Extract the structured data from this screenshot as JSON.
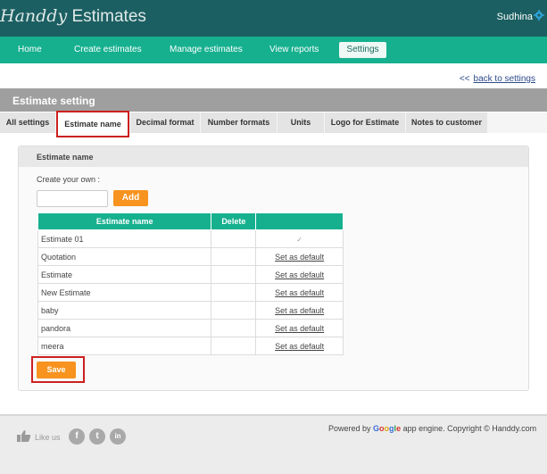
{
  "app": {
    "logo_script": "Handdy",
    "logo_rest": " Estimates",
    "user_name": "Sudhina"
  },
  "nav": {
    "items": [
      "Home",
      "Create estimates",
      "Manage estimates",
      "View reports"
    ],
    "settings": "Settings",
    "active": "Settings"
  },
  "back_link": {
    "arrow": "<<",
    "label": "back to settings"
  },
  "section_title": "Estimate setting",
  "tabs": [
    "All settings",
    "Estimate name",
    "Decimal format",
    "Number formats",
    "Units",
    "Logo for Estimate",
    "Notes to customer"
  ],
  "active_tab": "Estimate name",
  "panel": {
    "title": "Estimate name",
    "create_label": "Create your own :",
    "input_value": "",
    "add_label": "Add",
    "table": {
      "headers": [
        "Estimate name",
        "Delete",
        ""
      ],
      "rows": [
        {
          "name": "Estimate 01",
          "action": "✓",
          "is_default": true
        },
        {
          "name": "Quotation",
          "action": "Set as default",
          "is_default": false
        },
        {
          "name": "Estimate",
          "action": "Set as default",
          "is_default": false
        },
        {
          "name": "New Estimate",
          "action": "Set as default",
          "is_default": false
        },
        {
          "name": "baby",
          "action": "Set as default",
          "is_default": false
        },
        {
          "name": "pandora",
          "action": "Set as default",
          "is_default": false
        },
        {
          "name": "meera",
          "action": "Set as default",
          "is_default": false
        }
      ]
    },
    "save_label": "Save"
  },
  "footer": {
    "like": "Like us",
    "social": [
      "f",
      "t",
      "in"
    ],
    "powered_prefix": "Powered by ",
    "google": [
      "G",
      "o",
      "o",
      "g",
      "l",
      "e"
    ],
    "powered_suffix": " app engine. Copyright © Handdy.com"
  },
  "colors": {
    "topbar": "#1c5f62",
    "nav": "#16b08f",
    "accent_button": "#f7931e",
    "highlight_box": "#cc2020"
  }
}
